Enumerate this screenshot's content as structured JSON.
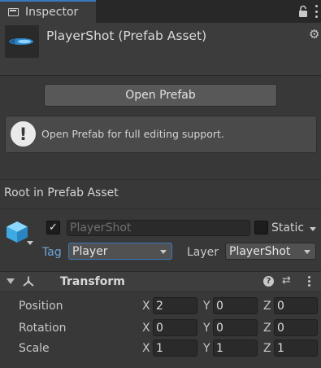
{
  "tab": {
    "title": "Inspector"
  },
  "asset": {
    "title": "PlayerShot (Prefab Asset)"
  },
  "open_prefab": {
    "label": "Open Prefab"
  },
  "help": {
    "icon": "!",
    "text": "Open Prefab for full editing support."
  },
  "root": {
    "label": "Root in Prefab Asset"
  },
  "gameobject": {
    "active_check": "✓",
    "name": "PlayerShot",
    "static_label": "Static",
    "tag_label": "Tag",
    "tag_value": "Player",
    "layer_label": "Layer",
    "layer_value": "PlayerShot"
  },
  "transform": {
    "title": "Transform",
    "help_icon": "?",
    "preset_icon": "⇄",
    "rows": [
      {
        "label": "Position",
        "x": "2",
        "y": "0",
        "z": "0"
      },
      {
        "label": "Rotation",
        "x": "0",
        "y": "0",
        "z": "0"
      },
      {
        "label": "Scale",
        "x": "1",
        "y": "1",
        "z": "1"
      }
    ],
    "axes": {
      "x": "X",
      "y": "Y",
      "z": "Z"
    }
  },
  "colors": {
    "accent": "#3a79bb",
    "tag_label": "#6da7dd",
    "cube": "#4fb4e8",
    "background": "#383838"
  }
}
